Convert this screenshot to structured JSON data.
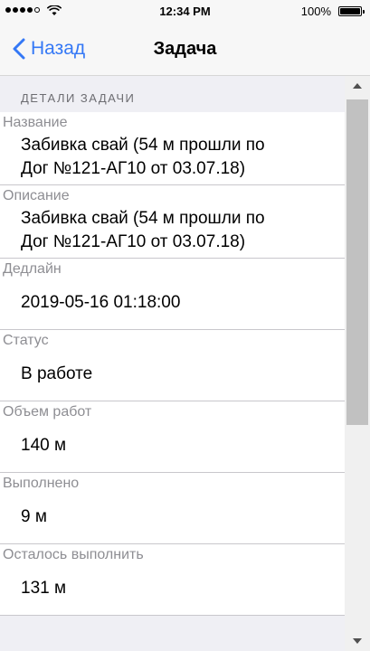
{
  "status_bar": {
    "time": "12:34 PM",
    "battery": "100%"
  },
  "nav": {
    "back_label": "Назад",
    "title": "Задача"
  },
  "section": {
    "header": "ДЕТАЛИ ЗАДАЧИ"
  },
  "fields": [
    {
      "label": "Название",
      "value_line1": "Забивка свай (54 м прошли по",
      "value_line2": "Дог №121-АГ10 от 03.07.18)"
    },
    {
      "label": "Описание",
      "value_line1": "Забивка свай (54 м прошли по",
      "value_line2": "Дог №121-АГ10 от 03.07.18)"
    },
    {
      "label": "Дедлайн",
      "value": "2019-05-16 01:18:00"
    },
    {
      "label": "Статус",
      "value": "В работе"
    },
    {
      "label": "Объем работ",
      "value": "140 м"
    },
    {
      "label": "Выполнено",
      "value": "9 м"
    },
    {
      "label": "Осталось выполнить",
      "value": "131 м"
    }
  ],
  "colors": {
    "accent": "#3478f6",
    "label": "#8e8e93",
    "nav_bg": "#f7f7f7"
  }
}
